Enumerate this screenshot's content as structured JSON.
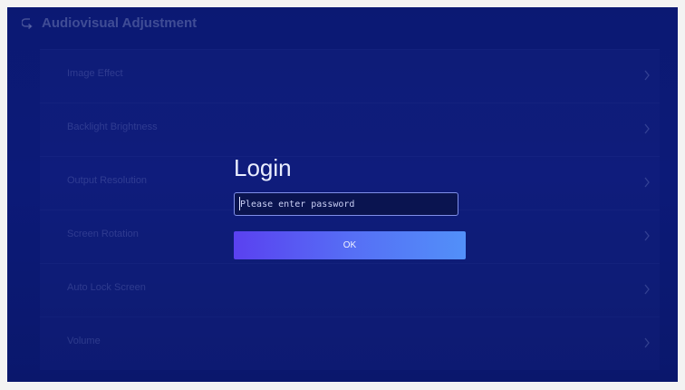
{
  "header": {
    "back_icon": "back-arrow-icon",
    "title": "Audiovisual Adjustment"
  },
  "settings": {
    "items": [
      {
        "label": "Image Effect",
        "icon": "chevron-right-icon"
      },
      {
        "label": "Backlight Brightness",
        "icon": "chevron-right-icon"
      },
      {
        "label": "Output Resolution",
        "icon": "chevron-right-icon"
      },
      {
        "label": "Screen Rotation",
        "icon": "chevron-right-icon"
      },
      {
        "label": "Auto Lock Screen",
        "icon": "chevron-right-icon"
      },
      {
        "label": "Volume",
        "icon": "chevron-right-icon"
      }
    ]
  },
  "login": {
    "title": "Login",
    "password_placeholder": "Please enter password",
    "password_value": "",
    "ok_label": "OK"
  },
  "colors": {
    "background": "#0e1e86",
    "button_gradient_start": "#5a41f0",
    "button_gradient_end": "#5290f9",
    "input_border": "#7f8fe8",
    "input_background": "#0a1450"
  }
}
